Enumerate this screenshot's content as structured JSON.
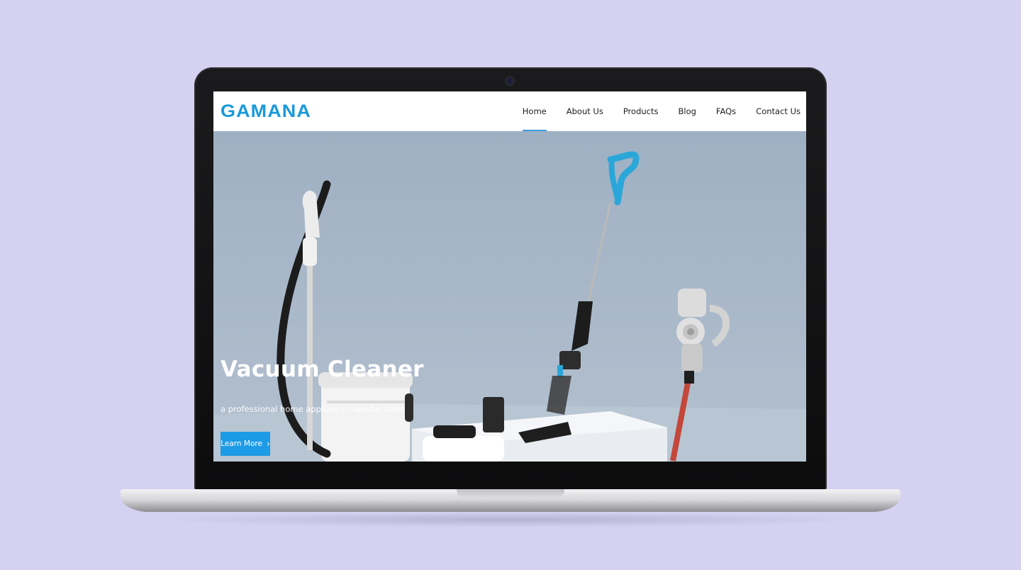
{
  "brand": {
    "logo": "GAMANA",
    "color": "#1a9ad9"
  },
  "nav": {
    "items": [
      {
        "label": "Home",
        "active": true
      },
      {
        "label": "About Us"
      },
      {
        "label": "Products"
      },
      {
        "label": "Blog"
      },
      {
        "label": "FAQs"
      },
      {
        "label": "Contact Us"
      }
    ]
  },
  "hero": {
    "title": "Vacuum Cleaner",
    "subtitle": "a professional home appliance manufacturer",
    "button": {
      "label": "Learn More",
      "icon": "chevron-right-icon"
    },
    "accent": "#1e9be6"
  }
}
